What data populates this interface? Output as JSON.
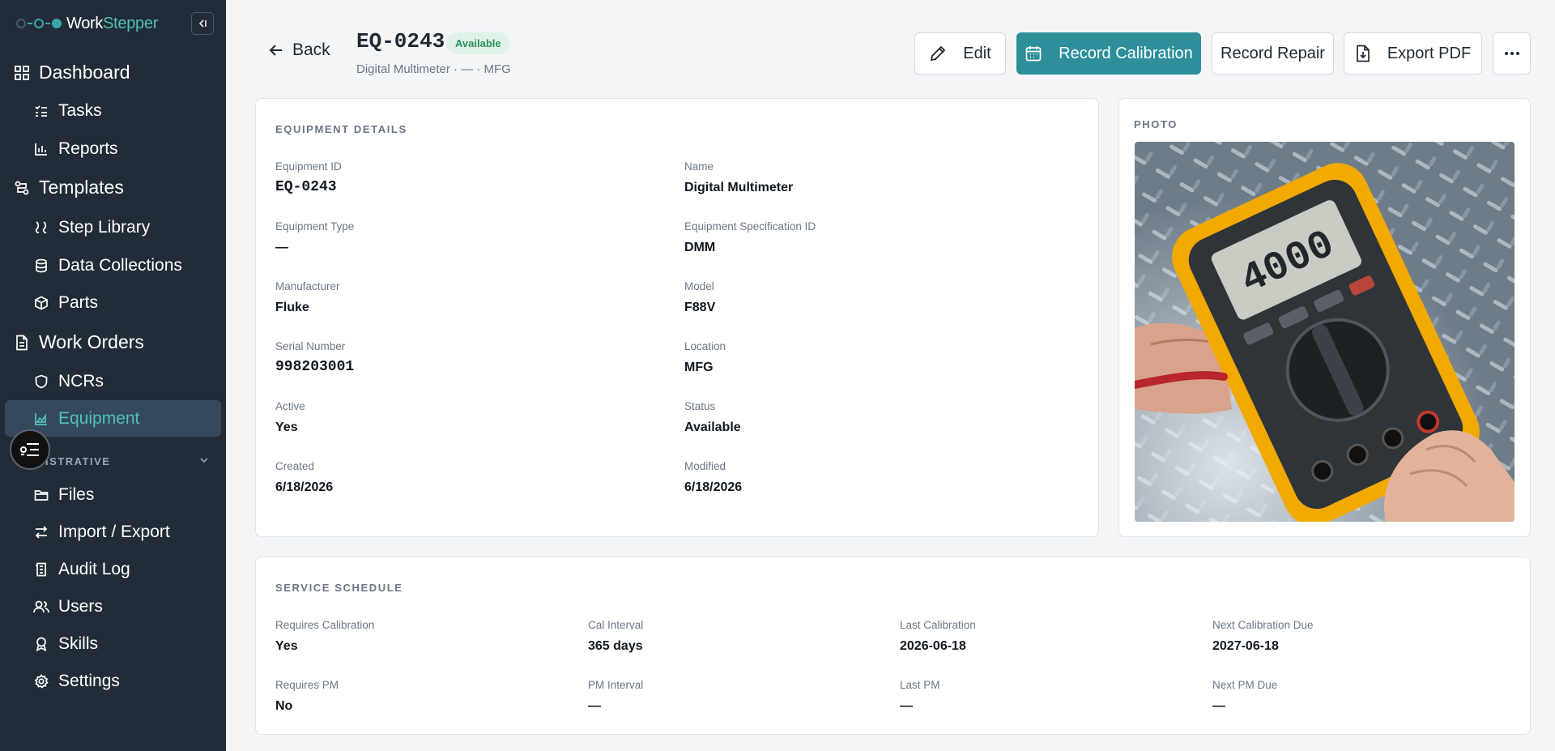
{
  "app": {
    "brand_a": "Work",
    "brand_b": "Stepper"
  },
  "sidebar": {
    "items": [
      {
        "label": "Dashboard",
        "icon": "dashboard-icon"
      },
      {
        "label": "Tasks",
        "icon": "list-check-icon"
      },
      {
        "label": "Reports",
        "icon": "bar-chart-icon"
      },
      {
        "label": "Templates",
        "icon": "templates-icon"
      },
      {
        "label": "Step Library",
        "icon": "steps-icon"
      },
      {
        "label": "Data Collections",
        "icon": "database-icon"
      },
      {
        "label": "Parts",
        "icon": "cube-icon"
      },
      {
        "label": "Work Orders",
        "icon": "document-icon"
      },
      {
        "label": "NCRs",
        "icon": "shield-icon"
      },
      {
        "label": "Equipment",
        "icon": "chart-area-icon"
      },
      {
        "label": "Files",
        "icon": "folder-icon"
      },
      {
        "label": "Import / Export",
        "icon": "arrows-exchange-icon"
      },
      {
        "label": "Audit Log",
        "icon": "audit-icon"
      },
      {
        "label": "Users",
        "icon": "users-icon"
      },
      {
        "label": "Skills",
        "icon": "award-icon"
      },
      {
        "label": "Settings",
        "icon": "gear-icon"
      }
    ],
    "section_label": "ISTRATIVE",
    "active": "Equipment"
  },
  "header": {
    "back_label": "Back",
    "title": "EQ-0243",
    "status_badge": "Available",
    "subtitle": "Digital Multimeter · — · MFG"
  },
  "actions": {
    "edit": "Edit",
    "record_calibration": "Record Calibration",
    "record_repair": "Record Repair",
    "export_pdf": "Export PDF"
  },
  "details": {
    "title": "EQUIPMENT DETAILS",
    "fields": [
      {
        "label": "Equipment ID",
        "value": "EQ-0243"
      },
      {
        "label": "Name",
        "value": "Digital Multimeter"
      },
      {
        "label": "Equipment Type",
        "value": "—"
      },
      {
        "label": "Equipment Specification ID",
        "value": "DMM"
      },
      {
        "label": "Manufacturer",
        "value": "Fluke"
      },
      {
        "label": "Model",
        "value": "F88V"
      },
      {
        "label": "Serial Number",
        "value": "998203001"
      },
      {
        "label": "Location",
        "value": "MFG"
      },
      {
        "label": "Active",
        "value": "Yes"
      },
      {
        "label": "Status",
        "value": "Available"
      },
      {
        "label": "Created",
        "value": "6/18/2026"
      },
      {
        "label": "Modified",
        "value": "6/18/2026"
      }
    ]
  },
  "photo": {
    "title": "PHOTO",
    "display_reading": "4000"
  },
  "schedule": {
    "title": "SERVICE SCHEDULE",
    "fields": [
      {
        "label": "Requires Calibration",
        "value": "Yes"
      },
      {
        "label": "Cal Interval",
        "value": "365 days"
      },
      {
        "label": "Last Calibration",
        "value": "2026-06-18"
      },
      {
        "label": "Next Calibration Due",
        "value": "2027-06-18"
      },
      {
        "label": "Requires PM",
        "value": "No"
      },
      {
        "label": "PM Interval",
        "value": "—"
      },
      {
        "label": "Last PM",
        "value": "—"
      },
      {
        "label": "Next PM Due",
        "value": "—"
      }
    ]
  },
  "colors": {
    "sidebar_bg": "#222c38",
    "accent": "#2e8f9b",
    "teal_text": "#4fc1b9",
    "badge_bg": "#dff3e9"
  }
}
